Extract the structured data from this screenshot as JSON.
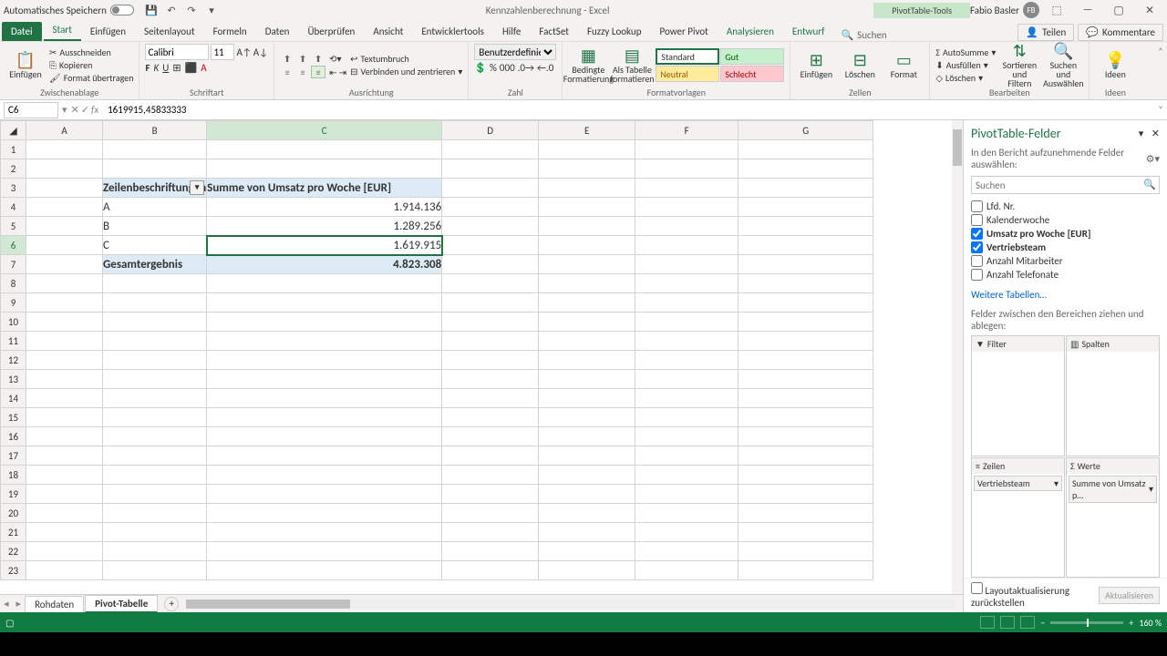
{
  "title": {
    "autosave": "Automatisches Speichern",
    "doc": "Kennzahlenberechnung  -  Excel",
    "pivottools": "PivotTable-Tools",
    "user": "Fabio Basler",
    "user_initials": "FB"
  },
  "tabs": {
    "file": "Datei",
    "items": [
      "Start",
      "Einfügen",
      "Seitenlayout",
      "Formeln",
      "Daten",
      "Überprüfen",
      "Ansicht",
      "Entwicklertools",
      "Hilfe",
      "FactSet",
      "Fuzzy Lookup",
      "Power Pivot",
      "Analysieren",
      "Entwurf"
    ],
    "search": "Suchen",
    "share": "Teilen",
    "comments": "Kommentare"
  },
  "ribbon": {
    "clipboard": {
      "label": "Zwischenablage",
      "paste": "Einfügen",
      "cut": "Ausschneiden",
      "copy": "Kopieren",
      "format": "Format übertragen"
    },
    "font": {
      "label": "Schriftart",
      "name": "Calibri",
      "size": "11"
    },
    "alignment": {
      "label": "Ausrichtung",
      "wrap": "Textumbruch",
      "merge": "Verbinden und zentrieren"
    },
    "number": {
      "label": "Zahl",
      "format": "Benutzerdefiniert"
    },
    "styles": {
      "label": "Formatvorlagen",
      "cond": "Bedingte Formatierung",
      "astable": "Als Tabelle formatieren",
      "std": "Standard",
      "gut": "Gut",
      "neu": "Neutral",
      "sch": "Schlecht"
    },
    "cells": {
      "label": "Zellen",
      "insert": "Einfügen",
      "delete": "Löschen",
      "format": "Format"
    },
    "editing": {
      "label": "Bearbeiten",
      "autosum": "AutoSumme",
      "fill": "Ausfüllen",
      "clear": "Löschen",
      "sort": "Sortieren und Filtern",
      "find": "Suchen und Auswählen"
    },
    "ideas": {
      "label": "Ideen",
      "btn": "Ideen"
    }
  },
  "namebox": "C6",
  "formula": "1619915,45833333",
  "columns": [
    "A",
    "B",
    "C",
    "D",
    "E",
    "F",
    "G"
  ],
  "pivot": {
    "rowlabel_hdr": "Zeilenbeschriftungen",
    "value_hdr": "Summe von Umsatz pro Woche [EUR]",
    "rows": [
      {
        "label": "A",
        "value": "1.914.136"
      },
      {
        "label": "B",
        "value": "1.289.256"
      },
      {
        "label": "C",
        "value": "1.619.915"
      }
    ],
    "total_label": "Gesamtergebnis",
    "total_value": "4.823.308"
  },
  "taskpane": {
    "title": "PivotTable-Felder",
    "subtitle": "In den Bericht aufzunehmende Felder auswählen:",
    "search_ph": "Suchen",
    "fields": [
      {
        "name": "Lfd. Nr.",
        "checked": false
      },
      {
        "name": "Kalenderwoche",
        "checked": false
      },
      {
        "name": "Umsatz pro Woche [EUR]",
        "checked": true
      },
      {
        "name": "Vertriebsteam",
        "checked": true
      },
      {
        "name": "Anzahl Mitarbeiter",
        "checked": false
      },
      {
        "name": "Anzahl Telefonate",
        "checked": false
      }
    ],
    "more_tables": "Weitere Tabellen…",
    "drag_label": "Felder zwischen den Bereichen ziehen und ablegen:",
    "area_filter": "Filter",
    "area_columns": "Spalten",
    "area_rows": "Zeilen",
    "area_values": "Werte",
    "row_item": "Vertriebsteam",
    "value_item": "Summe von Umsatz p…",
    "defer": "Layoutaktualisierung zurückstellen",
    "update": "Aktualisieren"
  },
  "sheets": {
    "tab1": "Rohdaten",
    "tab2": "Pivot-Tabelle"
  },
  "status": {
    "zoom": "160 %"
  }
}
